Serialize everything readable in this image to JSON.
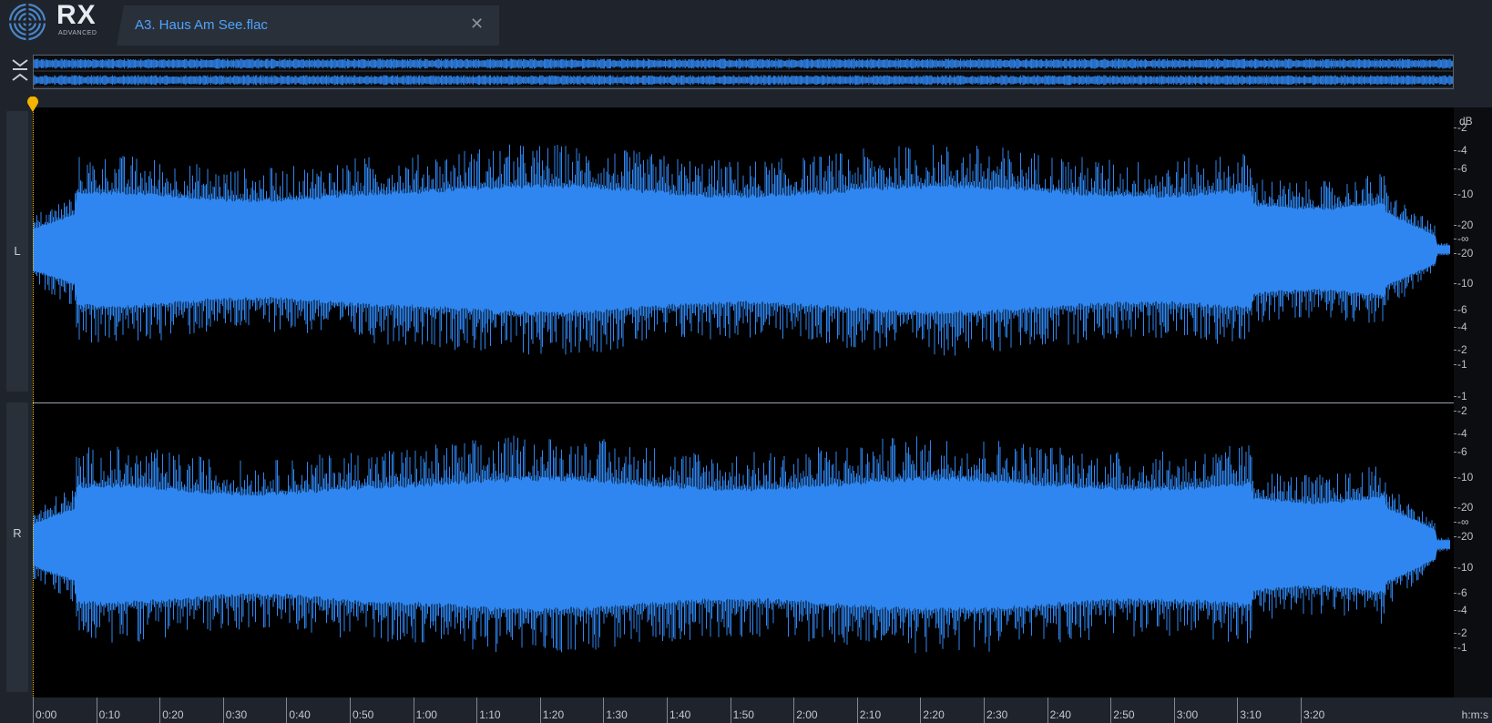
{
  "app": {
    "logo_text": "RX",
    "logo_subtext": "ADVANCED"
  },
  "tab": {
    "title": "A3. Haus Am See.flac",
    "close_glyph": "✕"
  },
  "channels": [
    {
      "label": "L"
    },
    {
      "label": "R"
    }
  ],
  "db_scale": {
    "unit": "dB",
    "left_ticks": [
      "-2",
      "-4",
      "-6",
      "-10",
      "-20",
      "-∞",
      "-20",
      "-10",
      "-6",
      "-4",
      "-2",
      "-1"
    ],
    "right_ticks": [
      "-1",
      "-2",
      "-4",
      "-6",
      "-10",
      "-20",
      "-∞",
      "-20",
      "-10",
      "-6",
      "-4",
      "-2",
      "-1"
    ]
  },
  "time_ruler": {
    "unit": "h:m:s",
    "labels": [
      "0:00",
      "0:10",
      "0:20",
      "0:30",
      "0:40",
      "0:50",
      "1:00",
      "1:10",
      "1:20",
      "1:30",
      "1:40",
      "1:50",
      "2:00",
      "2:10",
      "2:20",
      "2:30",
      "2:40",
      "2:50",
      "3:00",
      "3:10",
      "3:20"
    ]
  },
  "colors": {
    "waveform": "#2f86f0",
    "background": "#000000",
    "playhead": "#f2b400",
    "accent_text": "#4ea3ff"
  },
  "icons": {
    "logo": "rx-spiral-logo-icon",
    "close": "close-icon",
    "overview_toggle": "collapse-expand-icon",
    "playhead": "playhead-marker-icon"
  }
}
